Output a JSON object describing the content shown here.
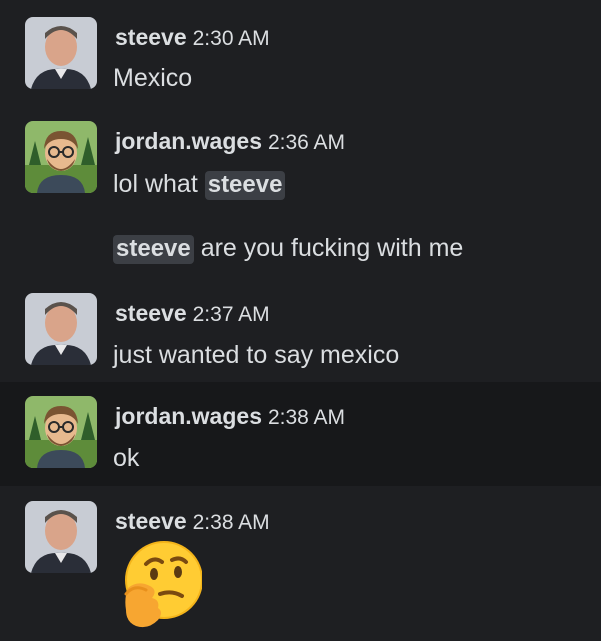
{
  "messages": [
    {
      "author": "steeve",
      "time": "2:30 AM",
      "text": "Mexico"
    },
    {
      "author": "jordan.wages",
      "time": "2:36 AM",
      "text_before": "lol what",
      "mention": "steeve"
    },
    {
      "continuation_mention": "steeve",
      "continuation_text": "are you fucking with me"
    },
    {
      "author": "steeve",
      "time": "2:37 AM",
      "text": "just wanted to say mexico"
    },
    {
      "author": "jordan.wages",
      "time": "2:38 AM",
      "text": "ok"
    },
    {
      "author": "steeve",
      "time": "2:38 AM",
      "emoji": "thinking-face"
    }
  ],
  "colors": {
    "background": "#1e1f22",
    "hover_background": "#17181a",
    "mention_bg": "#3c3f45",
    "text": "#dbdee1"
  }
}
